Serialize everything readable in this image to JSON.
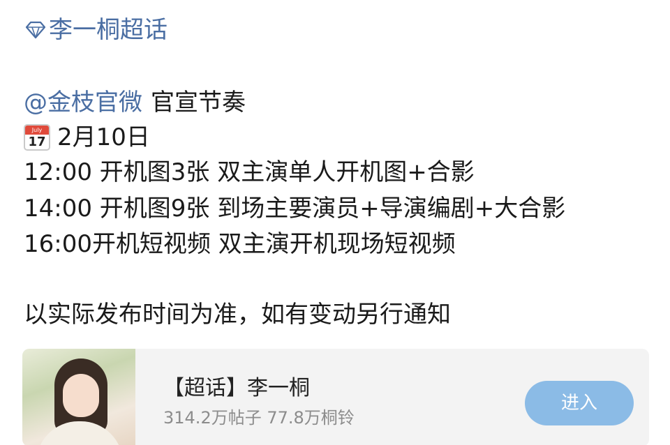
{
  "topic_tag": {
    "label": "李一桐超话",
    "icon": "diamond-icon"
  },
  "mention": {
    "handle": "@金枝官微",
    "text": "官宣节奏"
  },
  "date": {
    "calendar_month": "July",
    "calendar_day": "17",
    "text": "2月10日"
  },
  "schedule": [
    "12:00 开机图3张 双主演单人开机图+合影",
    "14:00  开机图9张 到场主要演员+导演编剧+大合影",
    "16:00开机短视频 双主演开机现场短视频"
  ],
  "note": "以实际发布时间为准，如有变动另行通知",
  "card": {
    "title": "【超话】李一桐",
    "stats": "314.2万帖子 77.8万桐铃",
    "enter_label": "进入",
    "button_color": "#8bbbe6"
  },
  "colors": {
    "link": "#4a6ea3",
    "text": "#1a1a1a",
    "calendar_red": "#e04a3b"
  }
}
